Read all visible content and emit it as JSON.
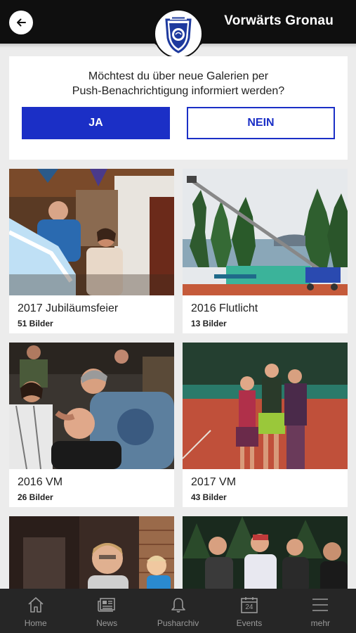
{
  "header": {
    "title": "Vorwärts Gronau",
    "back_icon": "arrow-left-icon",
    "logo_icon": "club-shield-logo"
  },
  "push_prompt": {
    "line1": "Möchtest du über neue Galerien per",
    "line2": "Push-Benachrichtigung informiert werden?",
    "yes_label": "JA",
    "no_label": "NEIN",
    "accent_color": "#1b2fc6"
  },
  "galleries": [
    {
      "title": "2017 Jubiläumsfeier",
      "count": "51 Bilder"
    },
    {
      "title": "2016 Flutlicht",
      "count": "13 Bilder"
    },
    {
      "title": "2016 VM",
      "count": "26 Bilder"
    },
    {
      "title": "2017 VM",
      "count": "43 Bilder"
    },
    {
      "title": "",
      "count": ""
    },
    {
      "title": "",
      "count": ""
    }
  ],
  "nav": {
    "items": [
      {
        "label": "Home",
        "icon": "home-icon"
      },
      {
        "label": "News",
        "icon": "newspaper-icon"
      },
      {
        "label": "Pusharchiv",
        "icon": "bell-icon"
      },
      {
        "label": "Events",
        "icon": "calendar-icon",
        "day": "24"
      },
      {
        "label": "mehr",
        "icon": "menu-icon"
      }
    ]
  }
}
